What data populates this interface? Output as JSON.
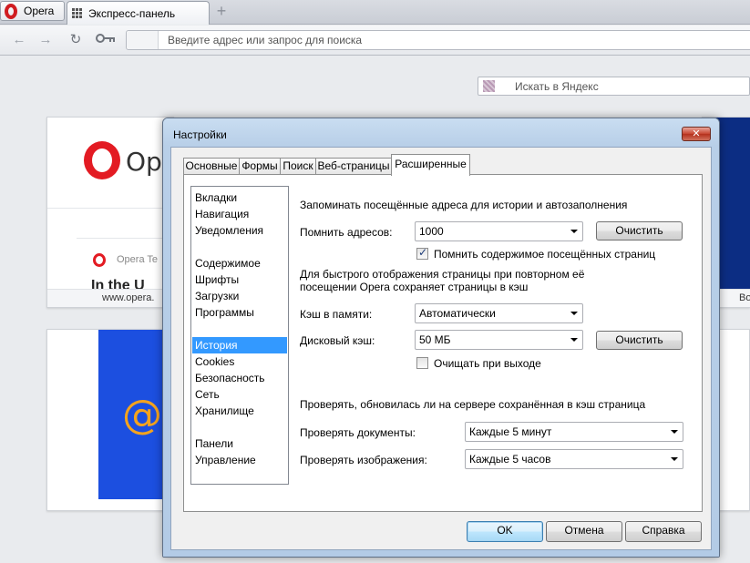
{
  "browser": {
    "menu_label": "Opera",
    "tab_title": "Экспресс-панель",
    "new_tab_symbol": "+",
    "address_placeholder": "Введите адрес или запрос для поиска"
  },
  "speed_dial": {
    "search_placeholder": "Искать в Яндекс",
    "tiles": [
      {
        "logo_text": "Ope",
        "mini_text": "Opera Te",
        "big_text": "In the U",
        "caption": "www.opera."
      },
      {
        "symbol": "@"
      }
    ],
    "right_caption": "Bo"
  },
  "dialog": {
    "title": "Настройки",
    "close_symbol": "✕",
    "tabs": [
      "Основные",
      "Формы",
      "Поиск",
      "Веб-страницы",
      "Расширенные"
    ],
    "active_tab": "Расширенные",
    "categories": [
      "Вкладки",
      "Навигация",
      "Уведомления",
      "Содержимое",
      "Шрифты",
      "Загрузки",
      "Программы",
      "История",
      "Cookies",
      "Безопасность",
      "Сеть",
      "Хранилище",
      "Панели",
      "Управление"
    ],
    "selected_category": "История",
    "history": {
      "heading": "Запоминать посещённые адреса для истории и автозаполнения",
      "remember_label": "Помнить адресов:",
      "remember_value": "1000",
      "clear_button": "Очистить",
      "remember_content_label": "Помнить содержимое посещённых страниц",
      "remember_content_checked": true
    },
    "cache": {
      "description_line1": "Для быстрого отображения страницы при повторном её",
      "description_line2": "посещении Opera сохраняет страницы в кэш",
      "memory_label": "Кэш в памяти:",
      "memory_value": "Автоматически",
      "disk_label": "Дисковый кэш:",
      "disk_value": "50 МБ",
      "clear_button": "Очистить",
      "clear_on_exit_label": "Очищать при выходе",
      "clear_on_exit_checked": false
    },
    "check": {
      "heading": "Проверять, обновилась ли на сервере сохранённая в кэш страница",
      "documents_label": "Проверять документы:",
      "documents_value": "Каждые 5 минут",
      "images_label": "Проверять изображения:",
      "images_value": "Каждые 5 часов"
    },
    "footer": {
      "ok": "OK",
      "cancel": "Отмена",
      "help": "Справка"
    }
  }
}
